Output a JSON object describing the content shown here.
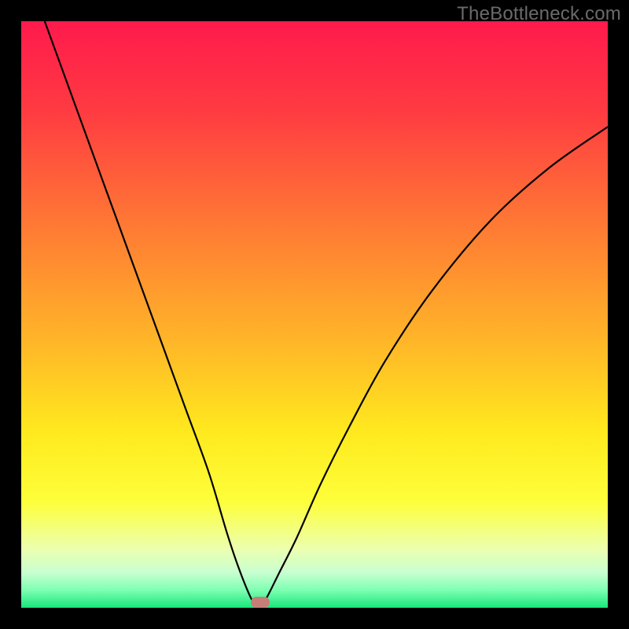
{
  "watermark": "TheBottleneck.com",
  "marker": {
    "x_pct": 40.8,
    "y_pct": 99.0,
    "color": "#c77e78"
  },
  "gradient_stops": [
    {
      "offset": 0,
      "color": "#ff1a4c"
    },
    {
      "offset": 15,
      "color": "#ff3a42"
    },
    {
      "offset": 35,
      "color": "#ff7a34"
    },
    {
      "offset": 55,
      "color": "#ffb728"
    },
    {
      "offset": 70,
      "color": "#ffe91e"
    },
    {
      "offset": 82,
      "color": "#fdff3a"
    },
    {
      "offset": 90,
      "color": "#ecffb0"
    },
    {
      "offset": 94,
      "color": "#c8ffd0"
    },
    {
      "offset": 97,
      "color": "#7dffb2"
    },
    {
      "offset": 100,
      "color": "#18e67a"
    }
  ],
  "chart_data": {
    "type": "line",
    "title": "",
    "xlabel": "",
    "ylabel": "",
    "xlim": [
      0,
      100
    ],
    "ylim": [
      0,
      100
    ],
    "series": [
      {
        "name": "bottleneck-curve",
        "x": [
          4,
          8,
          12,
          16,
          20,
          24,
          28,
          32,
          35,
          37,
          39,
          40,
          41,
          42,
          44,
          47,
          51,
          56,
          62,
          70,
          80,
          90,
          100
        ],
        "y": [
          100,
          89,
          78,
          67,
          56,
          45,
          34,
          23,
          13,
          7,
          2,
          0.5,
          0.5,
          2,
          6,
          12,
          21,
          31,
          42,
          54,
          66,
          75,
          82
        ]
      }
    ],
    "annotations": [
      {
        "text": "TheBottleneck.com",
        "position": "top-right"
      }
    ]
  }
}
